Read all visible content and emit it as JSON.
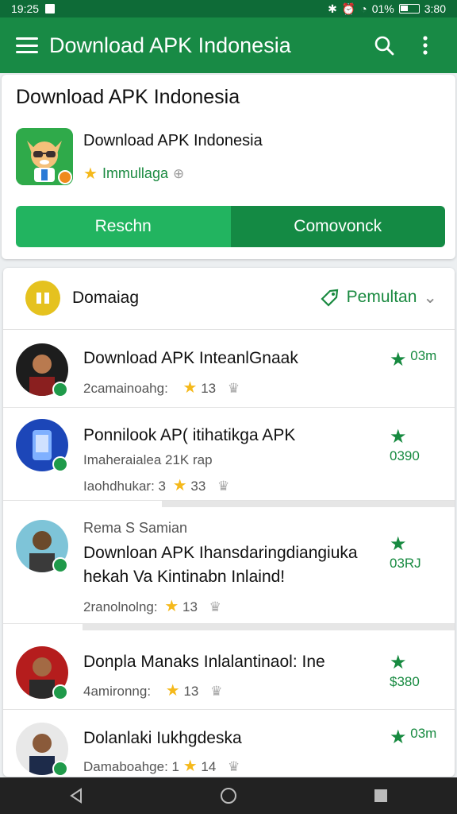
{
  "status_bar": {
    "time": "19:25",
    "right_text": "01%",
    "clock": "3:80"
  },
  "app_bar": {
    "title": "Download APK Indonesia",
    "icons": [
      "menu-icon",
      "search-icon",
      "more-vert-icon"
    ]
  },
  "header_card": {
    "title": "Download APK Indonesia",
    "app_name": "Download APK Indonesia",
    "rating_text": "Immullaga",
    "buttons": [
      "Reschn",
      "Comovonck"
    ]
  },
  "list_card": {
    "header_label": "Domaiag",
    "filter_label": "Pemultan",
    "items": [
      {
        "title": "Download APK InteanlGnaak",
        "line2": "2camainoahg:",
        "line3": "",
        "rating": "13",
        "badge": "03m"
      },
      {
        "title": "Ponnilook AP( itihatikga APK",
        "line2": "Imaheraialea 21K rap",
        "line3": "Iaohdhukar: 3",
        "rating": "33",
        "badge": "0390"
      },
      {
        "title": "Downloan APK Ihansdaringdiangiuka",
        "pre": "Rema S Samian",
        "line2": "hekah Va Kintinabn Inlaind!",
        "line3": "2ranolnolng:",
        "rating": "13",
        "badge": "03RJ"
      },
      {
        "title": "Donpla Manaks Inlalantinaol: Ine",
        "line2": "4amironng:",
        "line3": "",
        "rating": "13",
        "badge": "$380"
      },
      {
        "title": "Dolanlaki Iukhgdeska",
        "line2": "Damaboahge: 1",
        "line3": "",
        "rating": "14",
        "badge": "03m"
      }
    ]
  },
  "colors": {
    "primary": "#188a45",
    "accent": "#22b460",
    "star": "#f5b91b"
  }
}
